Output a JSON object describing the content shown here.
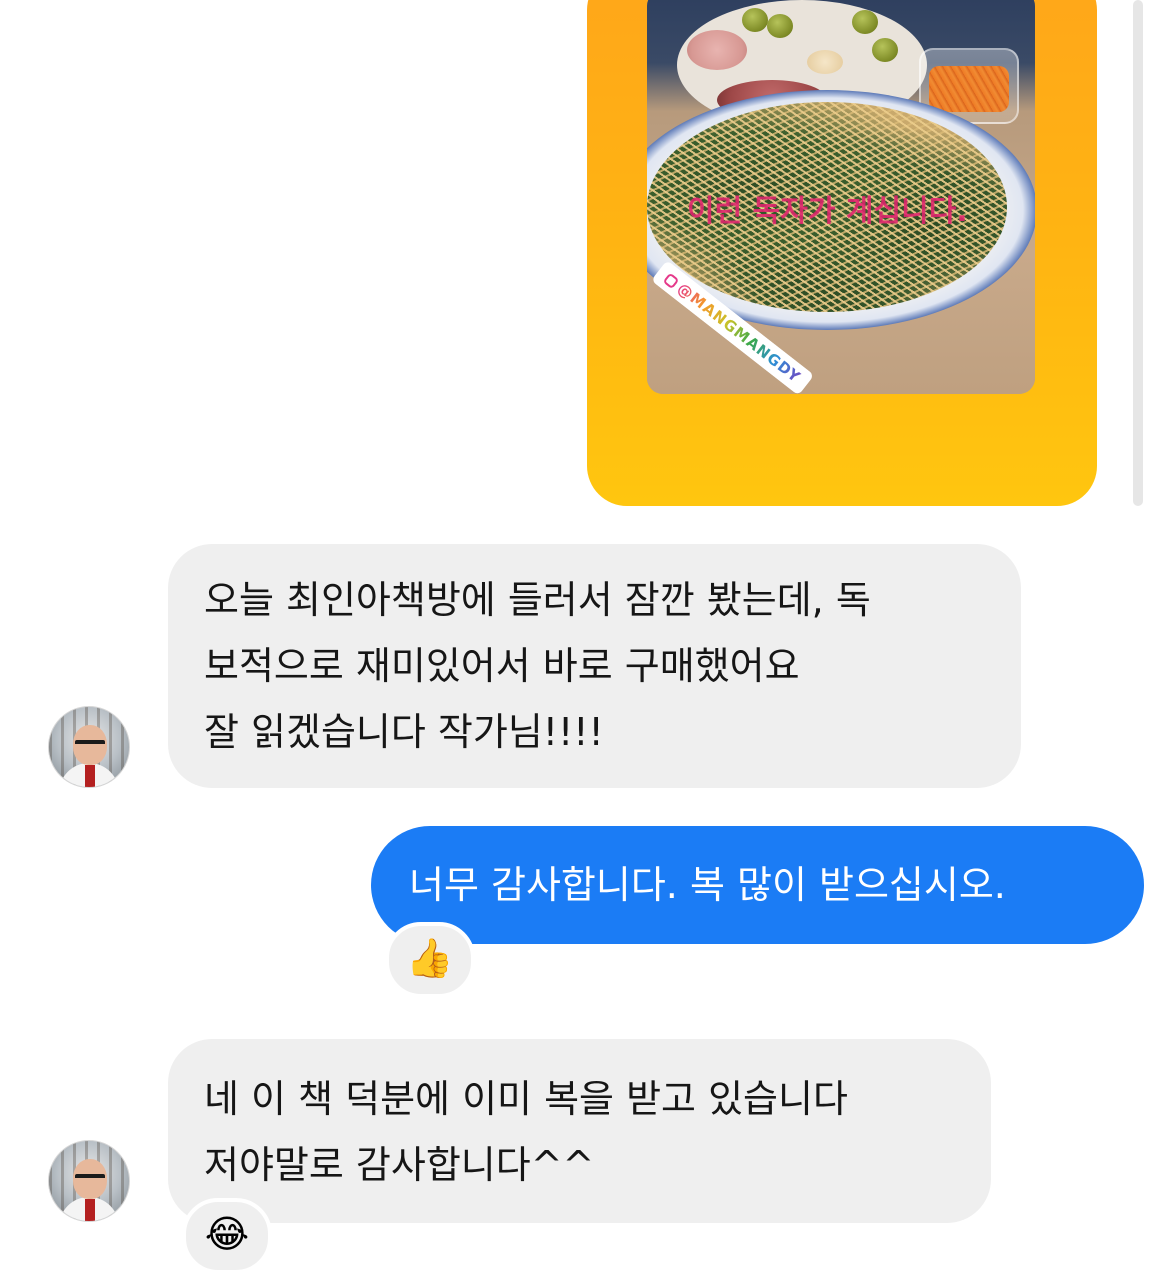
{
  "story": {
    "overlay_text": "이런 독자가 계십니다.",
    "mention": "@MANGMANGDY"
  },
  "messages": [
    {
      "id": "m1",
      "direction": "incoming",
      "lines": [
        "오늘 최인아책방에 들러서 잠깐 봤는데, 독",
        "보적으로 재미있어서 바로 구매했어요",
        "잘 읽겠습니다 작가님!!!!"
      ]
    },
    {
      "id": "m2",
      "direction": "outgoing",
      "lines": [
        "너무 감사합니다. 복 많이 받으십시오."
      ],
      "reaction": "👍"
    },
    {
      "id": "m3",
      "direction": "incoming",
      "lines": [
        "네 이 책 덕분에 이미 복을 받고 있습니다",
        "저야말로 감사합니다^^"
      ],
      "reaction": "😂"
    }
  ],
  "colors": {
    "outgoing_bubble": "#1b7cf5",
    "incoming_bubble": "#efefef",
    "story_frame": "#ffb412"
  },
  "icons": {
    "avatar": "user-avatar",
    "reaction_1": "thumbs-up-icon",
    "reaction_2": "tears-of-joy-icon"
  }
}
